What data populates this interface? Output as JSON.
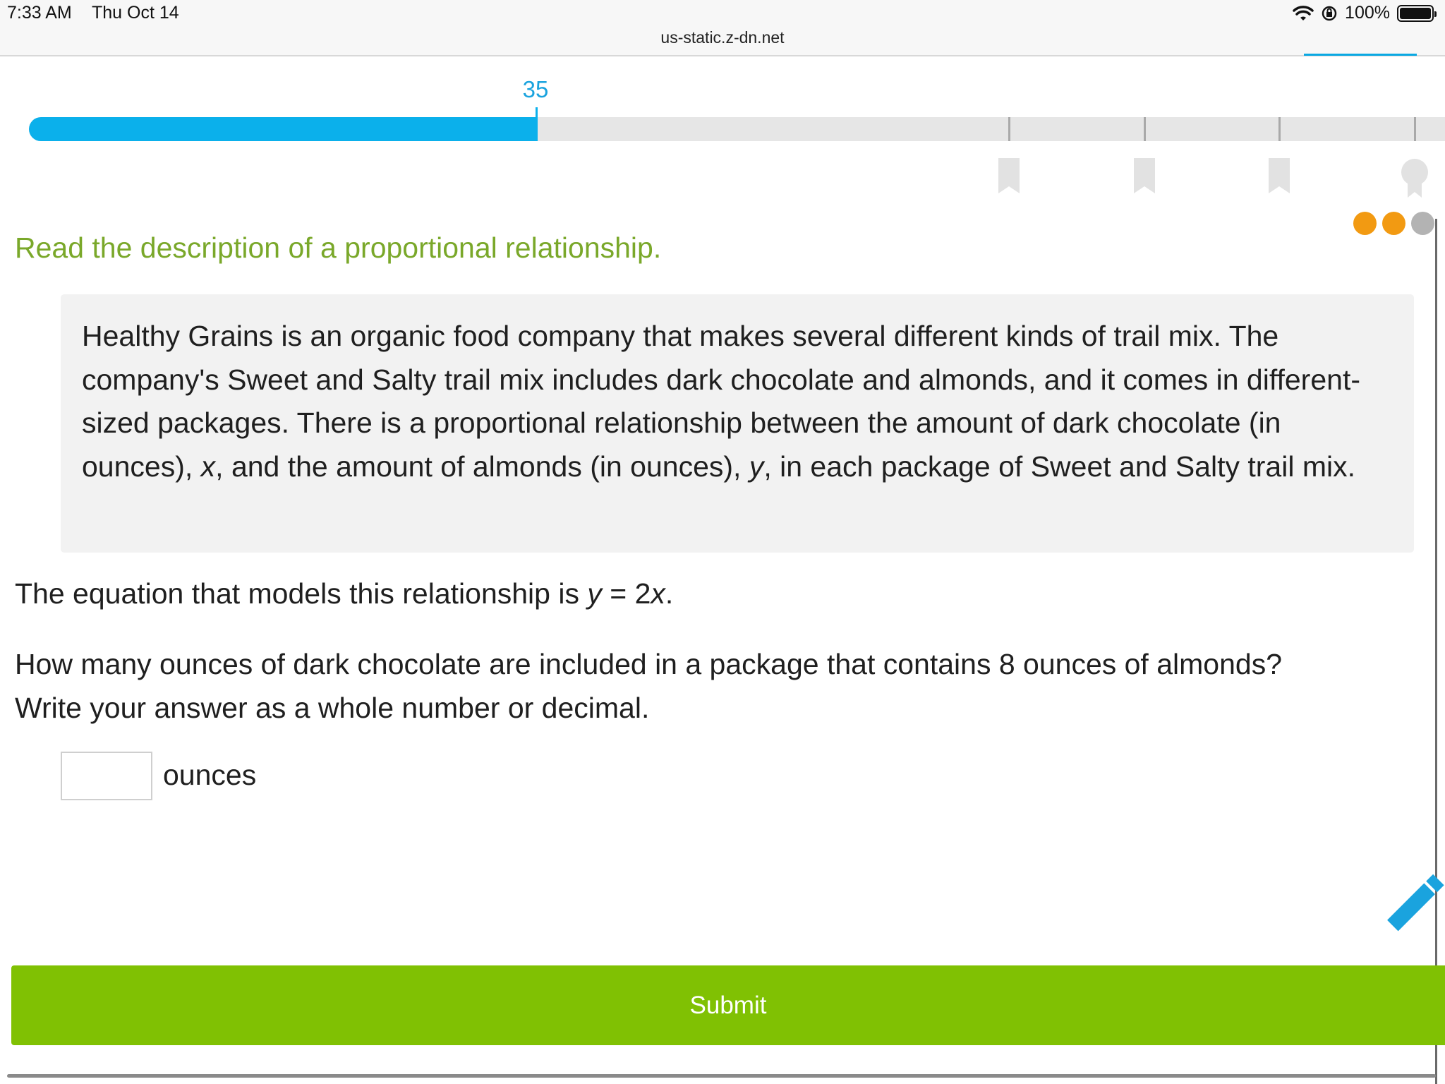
{
  "status_bar": {
    "time": "7:33 AM",
    "date": "Thu Oct 14",
    "battery": "100%",
    "url": "us-static.z-dn.net"
  },
  "progress": {
    "score": "35",
    "fraction": 0.35
  },
  "colors": {
    "accent_blue": "#0bb0eb",
    "instruction_green": "#7aa82a",
    "submit_green": "#80c103",
    "dot_orange": "#f29a12",
    "dot_gray": "#b3b3b3"
  },
  "question": {
    "instruction": "Read the description of a proportional relationship.",
    "description_parts": [
      "Healthy Grains is an organic food company that makes several different kinds of trail mix. The company's Sweet and Salty trail mix includes dark chocolate and almonds, and it comes in different-sized packages. There is a proportional relationship between the amount of dark chocolate (in ounces), ",
      "x",
      ", and the amount of almonds (in ounces), ",
      "y",
      ", in each package of Sweet and Salty trail mix."
    ],
    "equation_prefix": "The equation that models this relationship is ",
    "equation_y": "y",
    "equation_mid": " = 2",
    "equation_x": "x",
    "equation_end": ".",
    "prompt_line1": "How many ounces of dark chocolate are included in a package that contains 8 ounces of almonds?",
    "prompt_line2": "Write your answer as a whole number or decimal.",
    "answer_value": "",
    "unit": "ounces"
  },
  "icons": {
    "wifi": "wifi-icon",
    "orientation_lock": "orientation-lock-icon",
    "battery": "battery-icon",
    "bookmark": "bookmark-icon",
    "medal": "medal-icon",
    "pencil": "pencil-icon"
  },
  "submit_label": "Submit"
}
